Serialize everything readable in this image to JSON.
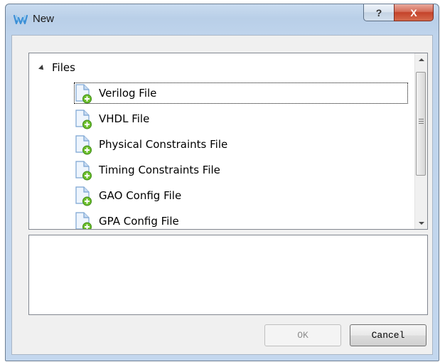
{
  "window": {
    "title": "New",
    "help_symbol": "?",
    "close_symbol": "X"
  },
  "tree": {
    "root_label": "Files",
    "root_expanded": true,
    "selected_index": 0,
    "items": [
      {
        "label": "Verilog File",
        "icon": "new-file-icon"
      },
      {
        "label": "VHDL File",
        "icon": "new-file-icon"
      },
      {
        "label": "Physical Constraints File",
        "icon": "new-file-icon"
      },
      {
        "label": "Timing Constraints File",
        "icon": "new-file-icon"
      },
      {
        "label": "GAO Config File",
        "icon": "new-file-icon"
      },
      {
        "label": "GPA Config File",
        "icon": "new-file-icon"
      }
    ]
  },
  "description": "",
  "buttons": {
    "ok": "OK",
    "ok_enabled": false,
    "cancel": "Cancel"
  },
  "colors": {
    "title_bar": "#bfd4ec",
    "close_button": "#c4432a",
    "icon_plus": "#6cbf2c",
    "icon_page": "#a9c7e8"
  }
}
